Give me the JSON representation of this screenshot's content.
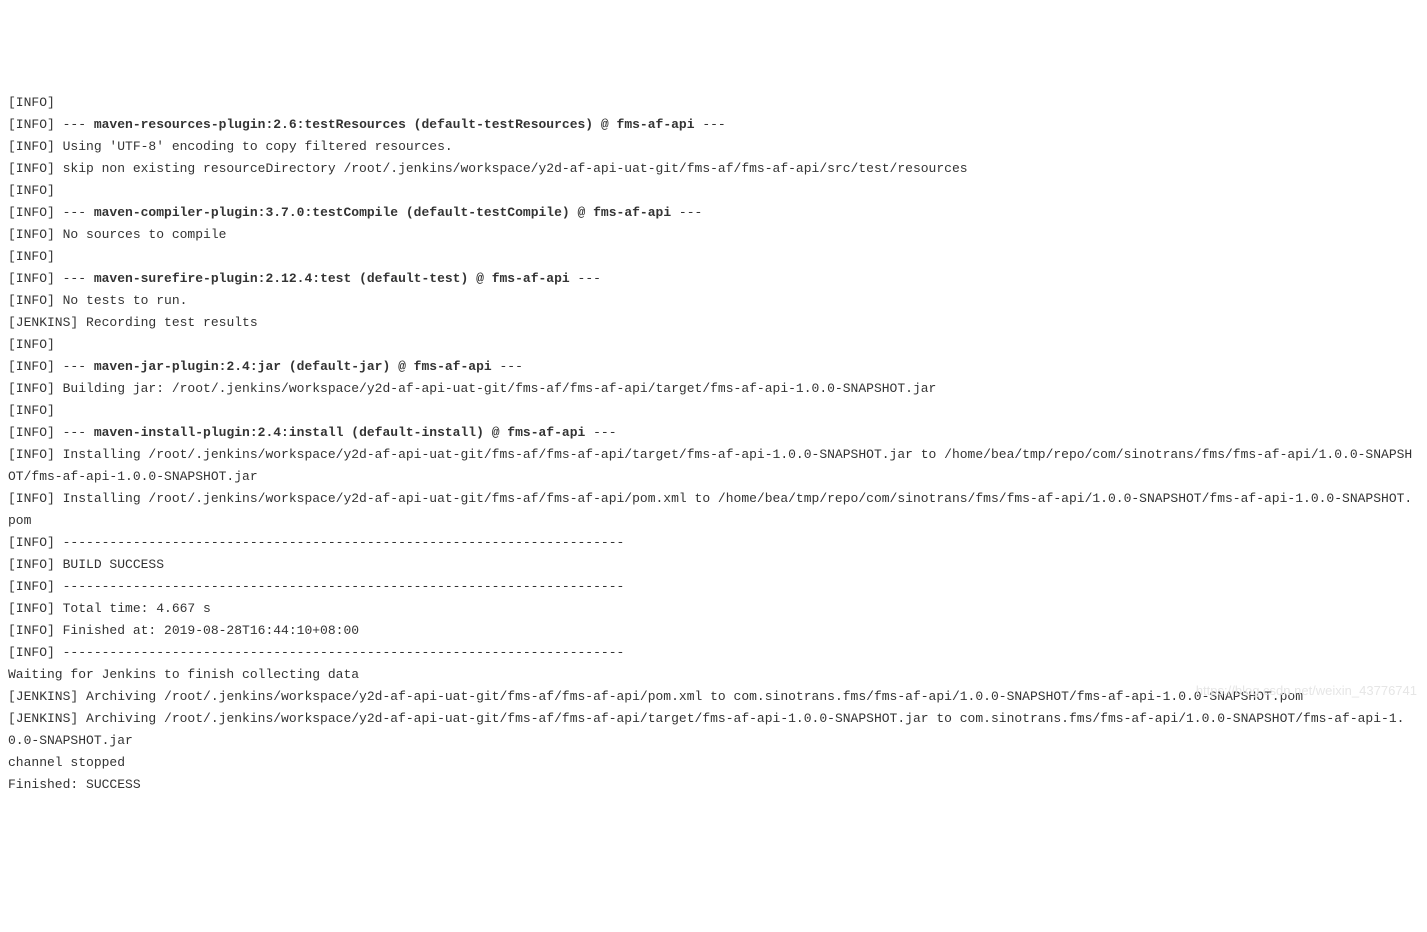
{
  "lines": [
    {
      "prefix": "[INFO] ",
      "text": ""
    },
    {
      "prefix": "[INFO] ",
      "pre": "--- ",
      "bold": "maven-resources-plugin:2.6:testResources (default-testResources) @ fms-af-api",
      "post": " ---"
    },
    {
      "prefix": "[INFO] ",
      "text": "Using 'UTF-8' encoding to copy filtered resources."
    },
    {
      "prefix": "[INFO] ",
      "text": "skip non existing resourceDirectory /root/.jenkins/workspace/y2d-af-api-uat-git/fms-af/fms-af-api/src/test/resources"
    },
    {
      "prefix": "[INFO] ",
      "text": ""
    },
    {
      "prefix": "[INFO] ",
      "pre": "--- ",
      "bold": "maven-compiler-plugin:3.7.0:testCompile (default-testCompile) @ fms-af-api",
      "post": " ---"
    },
    {
      "prefix": "[INFO] ",
      "text": "No sources to compile"
    },
    {
      "prefix": "[INFO] ",
      "text": ""
    },
    {
      "prefix": "[INFO] ",
      "pre": "--- ",
      "bold": "maven-surefire-plugin:2.12.4:test (default-test) @ fms-af-api",
      "post": " ---"
    },
    {
      "prefix": "[INFO] ",
      "text": "No tests to run."
    },
    {
      "prefix": "[JENKINS] ",
      "text": "Recording test results"
    },
    {
      "prefix": "[INFO] ",
      "text": ""
    },
    {
      "prefix": "[INFO] ",
      "pre": "--- ",
      "bold": "maven-jar-plugin:2.4:jar (default-jar) @ fms-af-api",
      "post": " ---"
    },
    {
      "prefix": "[INFO] ",
      "text": "Building jar: /root/.jenkins/workspace/y2d-af-api-uat-git/fms-af/fms-af-api/target/fms-af-api-1.0.0-SNAPSHOT.jar"
    },
    {
      "prefix": "[INFO] ",
      "text": ""
    },
    {
      "prefix": "[INFO] ",
      "pre": "--- ",
      "bold": "maven-install-plugin:2.4:install (default-install) @ fms-af-api",
      "post": " ---"
    },
    {
      "prefix": "[INFO] ",
      "text": "Installing /root/.jenkins/workspace/y2d-af-api-uat-git/fms-af/fms-af-api/target/fms-af-api-1.0.0-SNAPSHOT.jar to /home/bea/tmp/repo/com/sinotrans/fms/fms-af-api/1.0.0-SNAPSHOT/fms-af-api-1.0.0-SNAPSHOT.jar"
    },
    {
      "prefix": "[INFO] ",
      "text": "Installing /root/.jenkins/workspace/y2d-af-api-uat-git/fms-af/fms-af-api/pom.xml to /home/bea/tmp/repo/com/sinotrans/fms/fms-af-api/1.0.0-SNAPSHOT/fms-af-api-1.0.0-SNAPSHOT.pom"
    },
    {
      "prefix": "[INFO] ",
      "text": "------------------------------------------------------------------------"
    },
    {
      "prefix": "[INFO] ",
      "text": "BUILD SUCCESS"
    },
    {
      "prefix": "[INFO] ",
      "text": "------------------------------------------------------------------------"
    },
    {
      "prefix": "[INFO] ",
      "text": "Total time: 4.667 s"
    },
    {
      "prefix": "[INFO] ",
      "text": "Finished at: 2019-08-28T16:44:10+08:00"
    },
    {
      "prefix": "[INFO] ",
      "text": "------------------------------------------------------------------------"
    },
    {
      "prefix": "",
      "text": "Waiting for Jenkins to finish collecting data"
    },
    {
      "prefix": "[JENKINS] ",
      "text": "Archiving /root/.jenkins/workspace/y2d-af-api-uat-git/fms-af/fms-af-api/pom.xml to com.sinotrans.fms/fms-af-api/1.0.0-SNAPSHOT/fms-af-api-1.0.0-SNAPSHOT.pom"
    },
    {
      "prefix": "[JENKINS] ",
      "text": "Archiving /root/.jenkins/workspace/y2d-af-api-uat-git/fms-af/fms-af-api/target/fms-af-api-1.0.0-SNAPSHOT.jar to com.sinotrans.fms/fms-af-api/1.0.0-SNAPSHOT/fms-af-api-1.0.0-SNAPSHOT.jar"
    },
    {
      "prefix": "",
      "text": "channel stopped"
    },
    {
      "prefix": "",
      "text": "Finished: SUCCESS"
    }
  ],
  "watermark": "https://blog.csdn.net/weixin_43776741"
}
